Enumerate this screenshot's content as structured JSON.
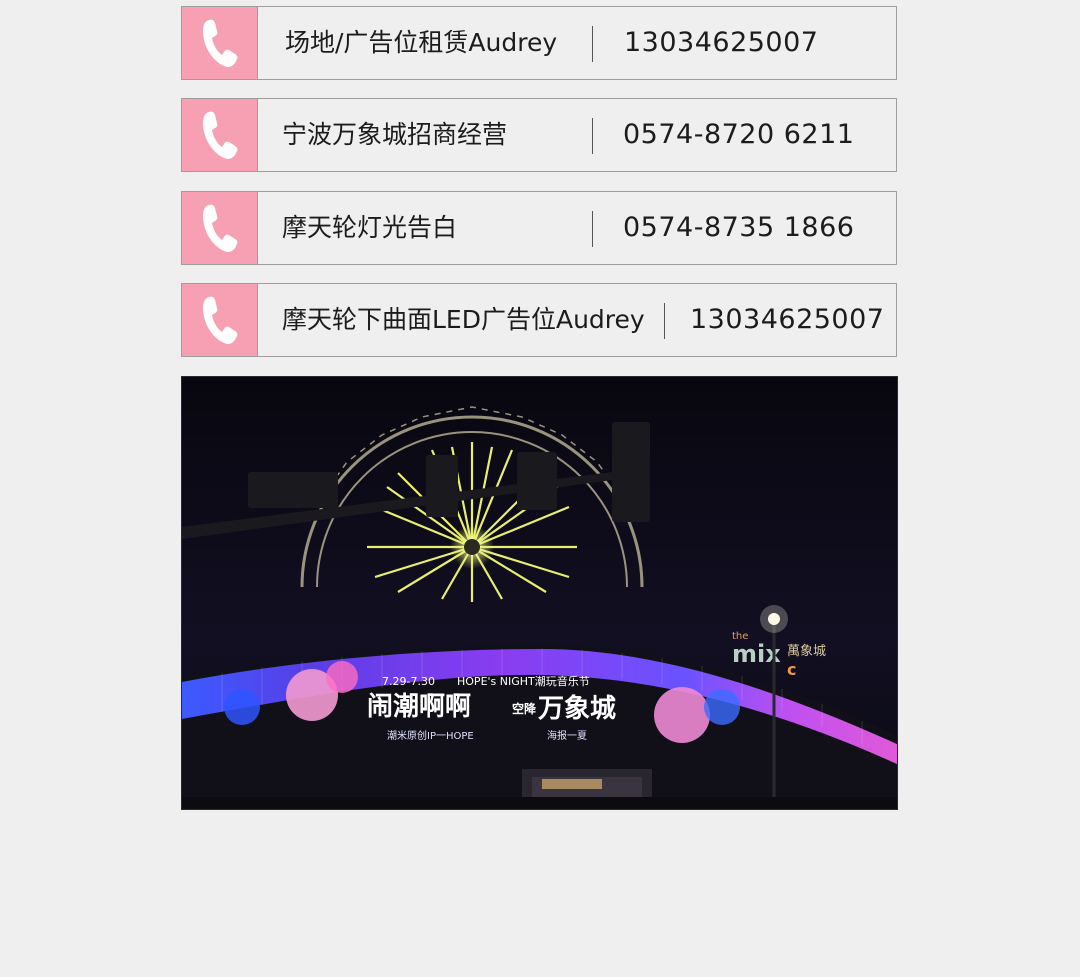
{
  "contacts": [
    {
      "label": "场地/广告位租赁Audrey",
      "number": "13034625007",
      "icon": "phone-icon"
    },
    {
      "label": "宁波万象城招商经营",
      "number": "0574-8720 6211",
      "icon": "phone-icon"
    },
    {
      "label": "摩天轮灯光告白",
      "number": "0574-8735 1866",
      "icon": "phone-icon"
    },
    {
      "label": "摩天轮下曲面LED广告位Audrey",
      "number": "13034625007",
      "icon": "phone-icon"
    }
  ],
  "photo": {
    "screen_date": "7.29-7.30",
    "screen_event": "HOPE's NIGHT潮玩音乐节",
    "screen_headline": "闹潮啊啊",
    "screen_headline2": "万象城",
    "screen_side": "空降",
    "screen_sub_left": "潮米原创IP一HOPE",
    "screen_sub_right": "海报一夏",
    "mall_sign_the": "the",
    "mall_sign_mix": "mix",
    "mall_sign_c": "c",
    "mall_sign_cn": "萬象城"
  },
  "colors": {
    "tile": "#f7a0b3",
    "border": "#9e9e9e",
    "background": "#efefef",
    "text": "#1c1c1c"
  }
}
